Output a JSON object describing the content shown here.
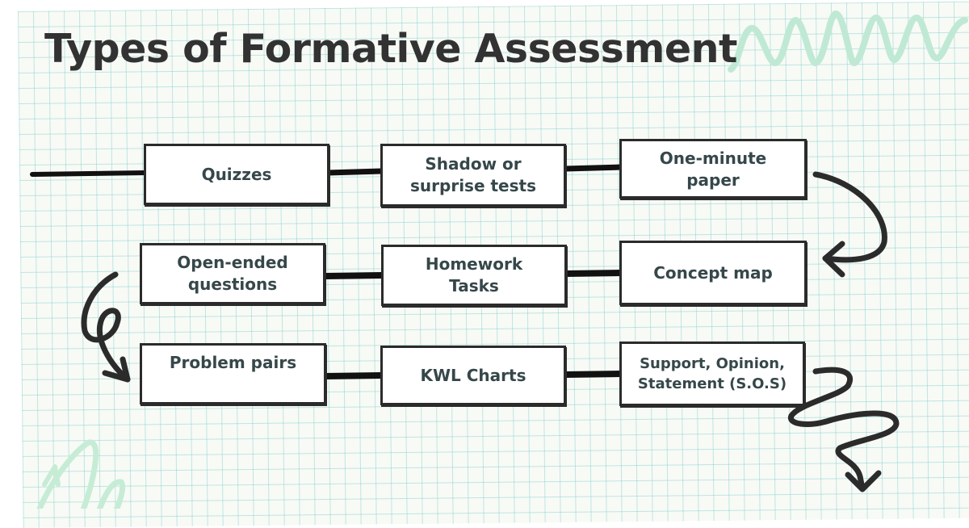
{
  "title": "Types of Formative Assessment",
  "colors": {
    "ink": "#2b2b2b",
    "text": "#36474a",
    "title": "#323232",
    "accent_mint": "#bfe9d4",
    "grid": "#78cdc8"
  },
  "rows": [
    {
      "boxes": [
        {
          "label": "Quizzes"
        },
        {
          "label": "Shadow or\nsurprise tests"
        },
        {
          "label": "One-minute\npaper"
        }
      ]
    },
    {
      "boxes": [
        {
          "label": "Open-ended\nquestions"
        },
        {
          "label": "Homework\nTasks"
        },
        {
          "label": "Concept map"
        }
      ]
    },
    {
      "boxes": [
        {
          "label": "Problem pairs"
        },
        {
          "label": "KWL Charts"
        },
        {
          "label": "Support, Opinion,\nStatement (S.O.S)"
        }
      ]
    }
  ],
  "decorations": [
    "zigzag-mint-icon",
    "loop-mint-icon",
    "curved-arrow-icon",
    "loop-arrow-icon",
    "squiggle-arrow-icon"
  ]
}
